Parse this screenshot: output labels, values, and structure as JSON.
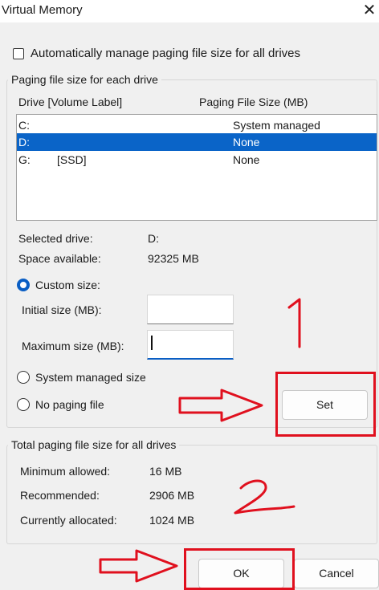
{
  "window": {
    "title": "Virtual Memory",
    "close_glyph": "✕"
  },
  "auto_manage": {
    "label": "Automatically manage paging file size for all drives",
    "checked": false
  },
  "paging_group": {
    "title": "Paging file size for each drive",
    "columns": {
      "drive": "Drive  [Volume Label]",
      "size": "Paging File Size (MB)"
    },
    "drives": [
      {
        "drive": "C:",
        "label": "",
        "size": "System managed",
        "selected": false
      },
      {
        "drive": "D:",
        "label": "",
        "size": "None",
        "selected": true
      },
      {
        "drive": "G:",
        "label": "[SSD]",
        "size": "None",
        "selected": false
      }
    ],
    "selected_drive_label": "Selected drive:",
    "selected_drive_value": "D:",
    "space_available_label": "Space available:",
    "space_available_value": "92325 MB",
    "custom_size_label": "Custom size:",
    "initial_size_label": "Initial size (MB):",
    "initial_size_value": "",
    "maximum_size_label": "Maximum size (MB):",
    "maximum_size_value": "",
    "system_managed_label": "System managed size",
    "no_paging_label": "No paging file",
    "set_button": "Set"
  },
  "total_group": {
    "title": "Total paging file size for all drives",
    "minimum_label": "Minimum allowed:",
    "minimum_value": "16 MB",
    "recommended_label": "Recommended:",
    "recommended_value": "2906 MB",
    "current_label": "Currently allocated:",
    "current_value": "1024 MB"
  },
  "buttons": {
    "ok": "OK",
    "cancel": "Cancel"
  },
  "annotation_colors": {
    "highlight": "#e0101e",
    "accent": "#0a5ec4",
    "selection": "#0a64c8"
  }
}
